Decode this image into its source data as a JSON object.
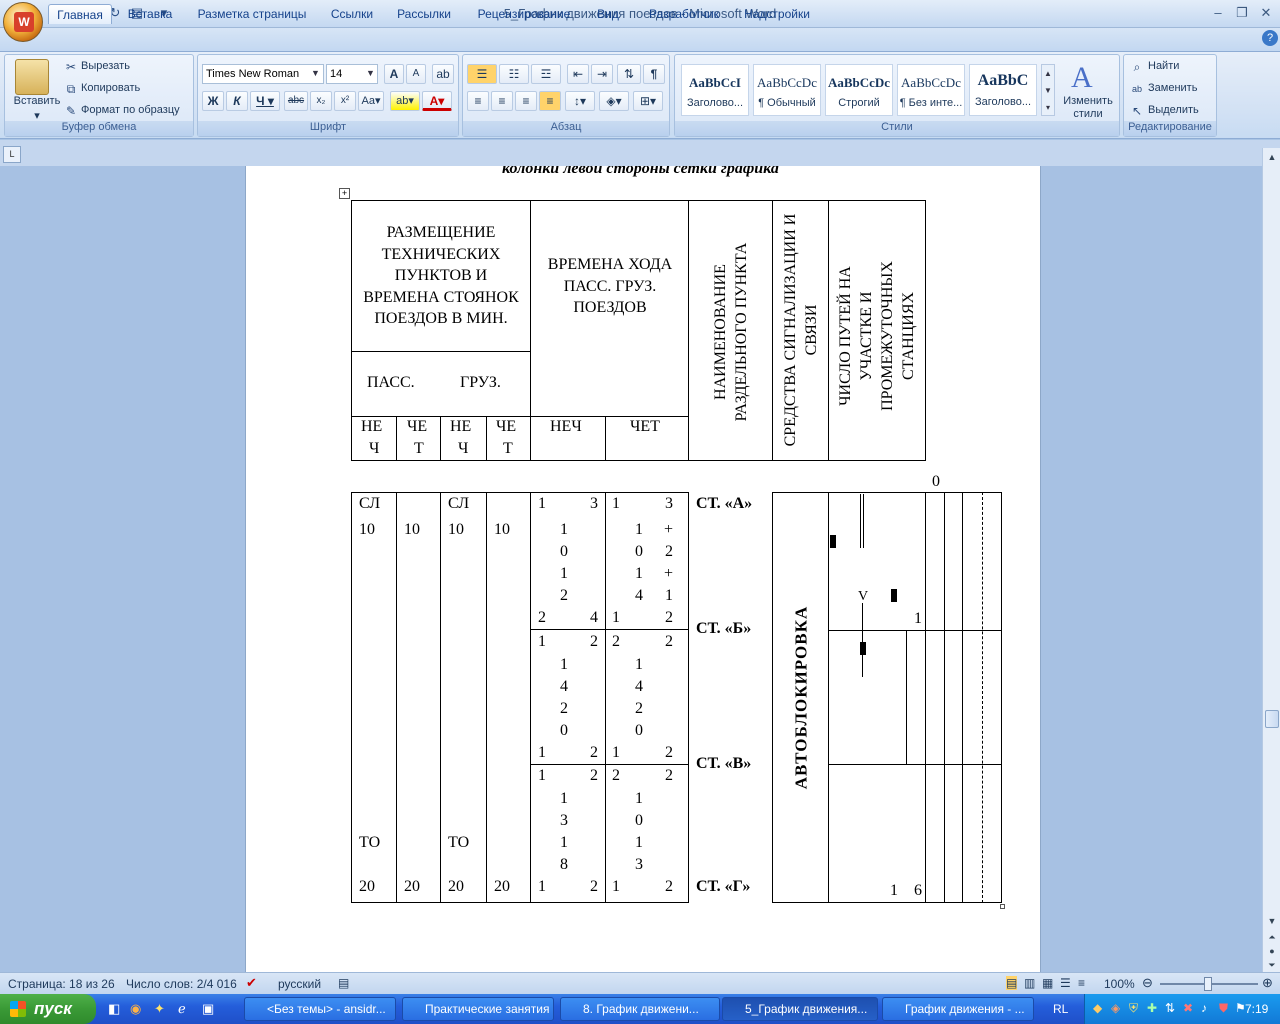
{
  "window": {
    "title": "5_График движения поездов - Microsoft Word"
  },
  "tabs": [
    "Главная",
    "Вставка",
    "Разметка страницы",
    "Ссылки",
    "Рассылки",
    "Рецензирование",
    "Вид",
    "Разработчик",
    "Надстройки"
  ],
  "clipboard": {
    "paste": "Вставить",
    "cut": "Вырезать",
    "copy": "Копировать",
    "format_painter": "Формат по образцу",
    "label": "Буфер обмена"
  },
  "font": {
    "name": "Times New Roman",
    "size": "14",
    "label": "Шрифт"
  },
  "paragraph": {
    "label": "Абзац"
  },
  "styles": {
    "items": [
      {
        "preview": "AaBbCcI",
        "name": "Заголово..."
      },
      {
        "preview": "AaBbCcDc",
        "name": "¶ Обычный"
      },
      {
        "preview": "AaBbCcDc",
        "name": "Строгий"
      },
      {
        "preview": "AaBbCcDc",
        "name": "¶ Без инте..."
      },
      {
        "preview": "AaBbC",
        "name": "Заголово..."
      }
    ],
    "change": "Изменить стили",
    "label": "Стили"
  },
  "editing": {
    "find": "Найти",
    "replace": "Заменить",
    "select": "Выделить",
    "label": "Редактирование"
  },
  "document": {
    "heading_partial": "колонки левой стороны сетки графика",
    "header": {
      "placement": "РАЗМЕЩЕНИЕ ТЕХНИЧЕСКИХ ПУНКТОВ И ВРЕМЕНА СТОЯНОК ПОЕЗДОВ В МИН.",
      "times": "ВРЕМЕНА ХОДА ПАСС. ГРУЗ. ПОЕЗДОВ",
      "station_name": "НАИМЕНОВАНИЕ РАЗДЕЛЬНОГО ПУНКТА",
      "signaling": "СРЕДСТВА СИГНАЛИЗАЦИИ И СВЯЗИ",
      "tracks": "ЧИСЛО ПУТЕЙ НА УЧАСТКЕ И ПРОМЕЖУТОЧНЫХ СТАНЦИЯХ",
      "pass": "ПАСС.",
      "freight": "ГРУЗ.",
      "nech": "НЕЧ",
      "chet": "ЧЕТ",
      "ne": "НЕ",
      "ch": "Ч",
      "che": "ЧЕ",
      "t": "Т"
    },
    "zero_mark": "0",
    "stations": [
      "СТ. «А»",
      "СТ. «Б»",
      "СТ. «В»",
      "СТ. «Г»"
    ],
    "autoblock": "АВТОБЛОКИРОВКА",
    "col_sl": "СЛ",
    "col_to": "ТО",
    "val_10": "10",
    "val_20": "20",
    "seg1_nech": [
      "1",
      "3",
      "1",
      "0",
      "1",
      "2",
      "2",
      "4"
    ],
    "seg1_chet": [
      "1",
      "3",
      "1",
      "+",
      "0",
      "2",
      "1",
      "+",
      "4",
      "1",
      "1",
      "2"
    ],
    "seg2_nech": [
      "1",
      "2",
      "1",
      "4",
      "2",
      "0",
      "1",
      "2"
    ],
    "seg2_chet": [
      "2",
      "2",
      "1",
      "4",
      "2",
      "0",
      "1",
      "2"
    ],
    "seg3_nech": [
      "1",
      "2",
      "1",
      "3",
      "1",
      "8",
      "1",
      "2"
    ],
    "seg3_chet": [
      "2",
      "2",
      "1",
      "0",
      "1",
      "3",
      "1",
      "2"
    ],
    "track_num_1": "1",
    "track_num_16a": "1",
    "track_num_16b": "6",
    "arrow": "V"
  },
  "status": {
    "page": "Страница: 18 из 26",
    "words": "Число слов: 2/4 016",
    "lang": "русский",
    "zoom": "100%"
  },
  "taskbar": {
    "start": "пуск",
    "tasks": [
      "<Без темы> - ansidr...",
      "Практические занятия",
      "8. График движени...",
      "5_График движения...",
      "График движения - ..."
    ],
    "lang": "RL",
    "time": "7:19"
  }
}
